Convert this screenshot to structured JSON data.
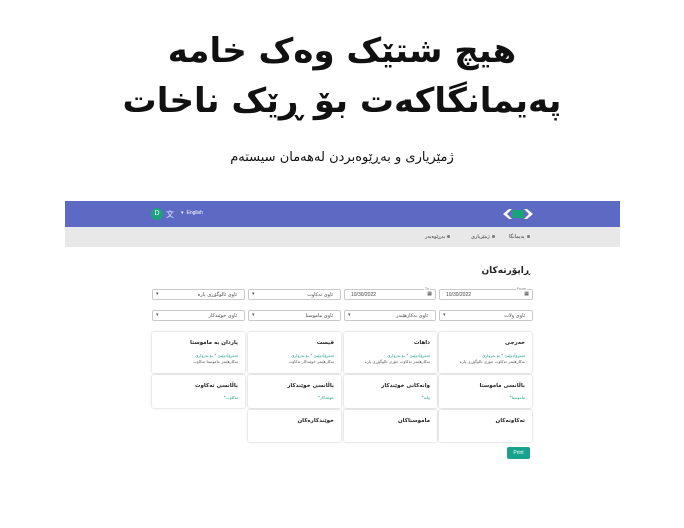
{
  "hero": {
    "title_line1": "هیچ شتێک وەک خامە",
    "title_line2": "پەیمانگاکەت بۆ ڕێک ناخات",
    "subtitle": "ژمێریاری و بەڕێوەبردن لەهەمان سیستەم"
  },
  "appbar": {
    "avatar_letter": "D",
    "language": "English",
    "colors": {
      "primary": "#5c6ac4",
      "avatar": "#1aa37a",
      "accent": "#18a38f"
    }
  },
  "tabs": [
    "پەیمانگا",
    "ژمێریاری",
    "بەڕێوەبەر"
  ],
  "page": {
    "title": "ڕاپۆرتەکان",
    "filters": {
      "currency": "ئاوی ئالوگۆڕی پارە",
      "payment_type": "ئاوی تەکاوت",
      "date_to_label": "To",
      "date_to": "10/30/2022",
      "date_from_label": "From",
      "date_from": "10/30/2022",
      "student": "ئاوی خوێندکار",
      "teacher": "ئاوی ماموستا",
      "employee": "ئاوی بەکارهێنەر",
      "institute": "ئاوی ولات"
    },
    "cards": [
      {
        "title": "پاردان بە ماموستا",
        "link": "ئەمڕۆ/دوێنێ * بۆ بەروارێ",
        "note": "بەکارهێنەر ماموستا تەکاوت"
      },
      {
        "title": "قیست",
        "link": "ئەمڕۆ/دوێنێ * بۆ بەروارێ",
        "note": "بەکارهێنەر خوێندکار تەکاوت"
      },
      {
        "title": "داهات",
        "link": "ئەمڕۆ/دوێنێ * بۆ بەروارێ",
        "note": "بەکارهێنەر تەکاوت جۆری ئالوگۆڕی پارە"
      },
      {
        "title": "خەرجی",
        "link": "ئەمڕۆ/دوێنێ * بۆ بەروارێ",
        "note": "بەکارهێنەر تەکاوت جۆری ئالوگۆڕی پارە"
      },
      {
        "title": "باڵانسی تەکاوت",
        "link": "تەکاوت*",
        "note": ""
      },
      {
        "title": "باڵانسی خوێندکار",
        "link": "خوێندکار*",
        "note": ""
      },
      {
        "title": "وانەکانی خوێندکار",
        "link": "وانە*",
        "note": ""
      },
      {
        "title": "باڵانسی ماموستا",
        "link": "ماموستا*",
        "note": ""
      },
      {
        "title": "خوێندکارەکان",
        "link": "",
        "note": ""
      },
      {
        "title": "ماموستاکان",
        "link": "",
        "note": ""
      },
      {
        "title": "تەکاوتەکان",
        "link": "",
        "note": ""
      }
    ],
    "print_label": "Print"
  }
}
